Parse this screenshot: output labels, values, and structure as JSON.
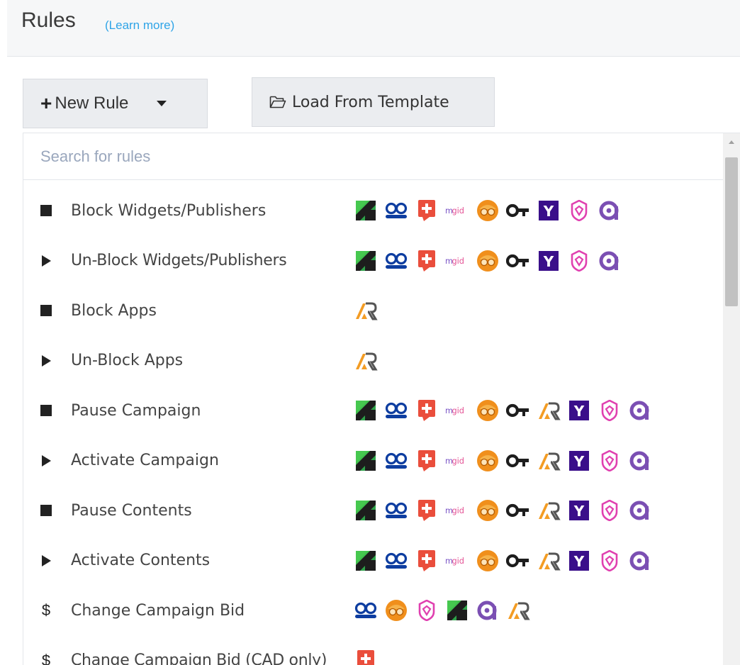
{
  "header": {
    "title": "Rules",
    "learn_more": "(Learn more)"
  },
  "toolbar": {
    "new_rule_label": "New Rule",
    "load_template_label": "Load From Template"
  },
  "search": {
    "placeholder": "Search for rules"
  },
  "colors": {
    "link": "#2fa4e7",
    "header_bg": "#f6f7f8",
    "button_bg": "#ebedf0"
  },
  "rules": [
    {
      "icon": "stop-square-icon",
      "label": "Block Widgets/Publishers",
      "platforms": [
        "revcontent",
        "outbrain",
        "content-ad",
        "mgid",
        "taboola-orange",
        "key-network",
        "yahoo",
        "shield-network",
        "q-network"
      ]
    },
    {
      "icon": "play-triangle-icon",
      "label": "Un-Block Widgets/Publishers",
      "platforms": [
        "revcontent",
        "outbrain",
        "content-ad",
        "mgid",
        "taboola-orange",
        "key-network",
        "yahoo",
        "shield-network",
        "q-network"
      ]
    },
    {
      "icon": "stop-square-icon",
      "label": "Block Apps",
      "platforms": [
        "ar-network"
      ]
    },
    {
      "icon": "play-triangle-icon",
      "label": "Un-Block Apps",
      "platforms": [
        "ar-network"
      ]
    },
    {
      "icon": "stop-square-icon",
      "label": "Pause Campaign",
      "platforms": [
        "revcontent",
        "outbrain",
        "content-ad",
        "mgid",
        "taboola-orange",
        "key-network",
        "ar-network",
        "yahoo",
        "shield-network",
        "q-network"
      ]
    },
    {
      "icon": "play-triangle-icon",
      "label": "Activate Campaign",
      "platforms": [
        "revcontent",
        "outbrain",
        "content-ad",
        "mgid",
        "taboola-orange",
        "key-network",
        "ar-network",
        "yahoo",
        "shield-network",
        "q-network"
      ]
    },
    {
      "icon": "stop-square-icon",
      "label": "Pause Contents",
      "platforms": [
        "revcontent",
        "outbrain",
        "content-ad",
        "mgid",
        "taboola-orange",
        "key-network",
        "ar-network",
        "yahoo",
        "shield-network",
        "q-network"
      ]
    },
    {
      "icon": "play-triangle-icon",
      "label": "Activate Contents",
      "platforms": [
        "revcontent",
        "outbrain",
        "content-ad",
        "mgid",
        "taboola-orange",
        "key-network",
        "ar-network",
        "yahoo",
        "shield-network",
        "q-network"
      ]
    },
    {
      "icon": "dollar-icon",
      "icon_text": "$",
      "label": "Change Campaign Bid",
      "platforms": [
        "outbrain",
        "taboola-orange",
        "shield-network",
        "revcontent",
        "q-network",
        "ar-network"
      ]
    },
    {
      "icon": "dollar-icon",
      "icon_text": "$",
      "label": "Change Campaign Bid (CAD only)",
      "platforms": [
        "content-ad"
      ]
    }
  ],
  "platform_text": {
    "mgid": "mgid",
    "yahoo": "Y"
  }
}
